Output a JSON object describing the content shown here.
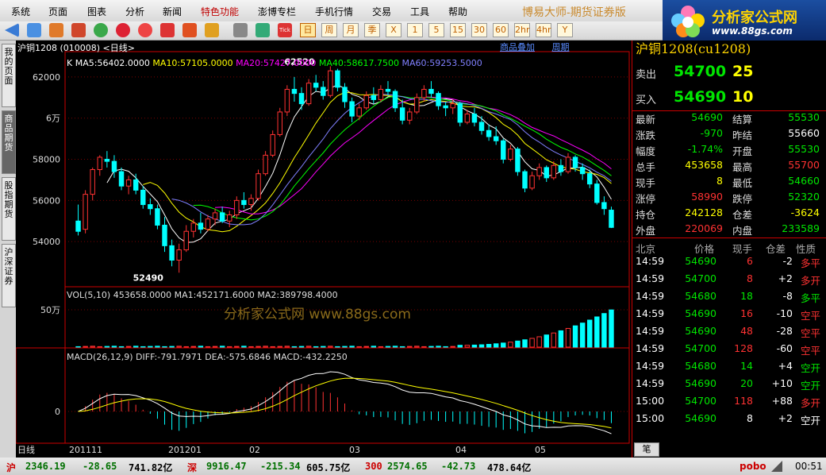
{
  "menu": [
    "系统",
    "页面",
    "图表",
    "分析",
    "新闻",
    "特色功能",
    "澎博专栏",
    "手机行情",
    "交易",
    "工具",
    "帮助"
  ],
  "brand": "博易大师-期货证券版",
  "logo": {
    "title": "分析家公式网",
    "url": "www.88gs.com"
  },
  "toolbar": {
    "period_tabs": [
      "日",
      "周",
      "月",
      "季",
      "X",
      "1",
      "5",
      "15",
      "30",
      "60",
      "2hr",
      "4hr",
      "Y"
    ],
    "tick_label": "Tick"
  },
  "sidebar": [
    "我的页面",
    "商品期货",
    "股指期货",
    "沪深证券"
  ],
  "chart": {
    "title": "沪铜1208 (010008)  <日线>",
    "links": [
      "商品叠加",
      "周期"
    ],
    "ma_label": "K",
    "ma": [
      {
        "t": "MA5:56402.0000",
        "c": "#ffffff"
      },
      {
        "t": "MA10:57105.0000",
        "c": "#ffff00"
      },
      {
        "t": "MA20:57427.0000",
        "c": "#ff00ff"
      },
      {
        "t": "MA40:58617.7500",
        "c": "#00ff00"
      },
      {
        "t": "MA60:59253.5000",
        "c": "#8080ff"
      }
    ],
    "y_ticks": [
      "62000",
      "6万",
      "58000",
      "56000",
      "54000"
    ],
    "hi_label": "62520",
    "lo_label": "52490",
    "vol_title": "VOL(5,10) 453658.0000 MA1:452171.6000 MA2:389798.4000",
    "vol_tick": "50万",
    "macd_title": "MACD(26,12,9) DIFF:-791.7971 DEA:-575.6846 MACD:-432.2250",
    "macd_tick": "0",
    "x_labels": [
      "日线",
      "201111",
      "201201",
      "02",
      "03",
      "04",
      "05"
    ],
    "watermark": "分析家公式网 www.88gs.com"
  },
  "quote": {
    "header": "沪铜1208(cu1208)",
    "sell": {
      "label": "卖出",
      "price": "54700",
      "vol": "25"
    },
    "buy": {
      "label": "买入",
      "price": "54690",
      "vol": "10"
    },
    "rows": [
      [
        [
          "最新",
          "54690",
          "green"
        ],
        [
          "结算",
          "55530",
          "green"
        ]
      ],
      [
        [
          "涨跌",
          "-970",
          "green"
        ],
        [
          "昨结",
          "55660",
          "white"
        ]
      ],
      [
        [
          "幅度",
          "-1.74%",
          "green"
        ],
        [
          "开盘",
          "55530",
          "green"
        ]
      ],
      [
        [
          "总手",
          "453658",
          "yellow"
        ],
        [
          "最高",
          "55700",
          "red"
        ]
      ],
      [
        [
          "现手",
          "8",
          "yellow"
        ],
        [
          "最低",
          "54660",
          "green"
        ]
      ],
      [
        [
          "涨停",
          "58990",
          "red"
        ],
        [
          "跌停",
          "52320",
          "green"
        ]
      ],
      [
        [
          "持仓",
          "242128",
          "yellow"
        ],
        [
          "仓差",
          "-3624",
          "yellow"
        ]
      ],
      [
        [
          "外盘",
          "220069",
          "red"
        ],
        [
          "内盘",
          "233589",
          "green"
        ]
      ]
    ],
    "tick_header": [
      "北京",
      "价格",
      "现手",
      "仓差",
      "性质"
    ],
    "ticks": [
      [
        "14:59",
        "54690",
        "6",
        "-2",
        "多平",
        "red"
      ],
      [
        "14:59",
        "54700",
        "8",
        "+2",
        "多开",
        "red"
      ],
      [
        "14:59",
        "54680",
        "18",
        "-8",
        "多平",
        "green"
      ],
      [
        "14:59",
        "54690",
        "16",
        "-10",
        "空平",
        "red"
      ],
      [
        "14:59",
        "54690",
        "48",
        "-28",
        "空平",
        "red"
      ],
      [
        "14:59",
        "54700",
        "128",
        "-60",
        "空平",
        "red"
      ],
      [
        "14:59",
        "54680",
        "14",
        "+4",
        "空开",
        "green"
      ],
      [
        "14:59",
        "54690",
        "20",
        "+10",
        "空开",
        "green"
      ],
      [
        "15:00",
        "54700",
        "118",
        "+88",
        "多开",
        "red"
      ],
      [
        "15:00",
        "54690",
        "8",
        "+2",
        "空开",
        "white"
      ]
    ],
    "tab": "笔"
  },
  "status": {
    "sh": {
      "name": "沪",
      "idx": "2346.19",
      "chg": "-28.65",
      "amt": "741.82亿"
    },
    "sz": {
      "name": "深",
      "idx": "9916.47",
      "chg": "-215.34",
      "amt": "605.75亿"
    },
    "hs": {
      "name": "300",
      "idx": "2574.65",
      "chg": "-42.73",
      "amt": "478.64亿"
    },
    "brand": "pobo",
    "time": "00:51"
  },
  "chart_data": {
    "type": "candlestick",
    "title": "沪铜1208 (010008) <日线>",
    "categories_sample": [
      "201111",
      "201201",
      "02",
      "03",
      "04",
      "05"
    ],
    "ohlc": [
      [
        55000,
        55800,
        54300,
        54500
      ],
      [
        54600,
        56500,
        54400,
        56300
      ],
      [
        56300,
        57600,
        56000,
        57500
      ],
      [
        57500,
        58200,
        57200,
        58100
      ],
      [
        58000,
        58400,
        57600,
        57900
      ],
      [
        57900,
        58200,
        57100,
        57400
      ],
      [
        57400,
        57600,
        56500,
        56700
      ],
      [
        56700,
        57200,
        56300,
        57000
      ],
      [
        57000,
        57300,
        56300,
        56500
      ],
      [
        56500,
        56700,
        55600,
        55800
      ],
      [
        55800,
        56100,
        55300,
        55600
      ],
      [
        55600,
        55800,
        54600,
        54800
      ],
      [
        54800,
        55200,
        53500,
        53800
      ],
      [
        53800,
        54100,
        52800,
        53100
      ],
      [
        53100,
        53900,
        52490,
        53600
      ],
      [
        53600,
        54800,
        53500,
        54500
      ],
      [
        54500,
        55100,
        54200,
        54900
      ],
      [
        54900,
        55400,
        54400,
        54600
      ],
      [
        54600,
        55300,
        54500,
        55100
      ],
      [
        55100,
        55600,
        54800,
        55400
      ],
      [
        55400,
        55700,
        54900,
        55000
      ],
      [
        55000,
        55500,
        54700,
        55300
      ],
      [
        55300,
        56200,
        55100,
        56000
      ],
      [
        56000,
        56400,
        55600,
        55800
      ],
      [
        55800,
        56300,
        55500,
        56100
      ],
      [
        56100,
        57500,
        56000,
        57300
      ],
      [
        57300,
        58400,
        57200,
        58200
      ],
      [
        58200,
        59400,
        58100,
        59200
      ],
      [
        59200,
        60500,
        59100,
        60300
      ],
      [
        60300,
        61600,
        60100,
        61400
      ],
      [
        61400,
        62000,
        60800,
        61200
      ],
      [
        61200,
        61500,
        60400,
        60700
      ],
      [
        60700,
        61900,
        60600,
        61700
      ],
      [
        61700,
        62100,
        61300,
        61500
      ],
      [
        61500,
        61800,
        60900,
        61100
      ],
      [
        61100,
        62520,
        61000,
        62300
      ],
      [
        62300,
        62400,
        61300,
        61500
      ],
      [
        61500,
        61700,
        60500,
        60800
      ],
      [
        60800,
        61000,
        59800,
        60100
      ],
      [
        60100,
        60700,
        59900,
        60500
      ],
      [
        60500,
        61300,
        60400,
        61100
      ],
      [
        61100,
        61500,
        60700,
        60900
      ],
      [
        60900,
        61600,
        60800,
        61400
      ],
      [
        61400,
        61800,
        61100,
        61300
      ],
      [
        61300,
        61400,
        60300,
        60500
      ],
      [
        60500,
        60900,
        59700,
        59900
      ],
      [
        59900,
        60500,
        59700,
        60300
      ],
      [
        60300,
        61200,
        60200,
        61000
      ],
      [
        61000,
        61600,
        60800,
        61400
      ],
      [
        61400,
        61800,
        61000,
        61200
      ],
      [
        61200,
        61300,
        60400,
        60600
      ],
      [
        60600,
        60800,
        60100,
        60500
      ],
      [
        60500,
        60900,
        60200,
        60700
      ],
      [
        60700,
        60800,
        59600,
        59800
      ],
      [
        59800,
        60400,
        59700,
        60200
      ],
      [
        60200,
        60500,
        59600,
        59800
      ],
      [
        59800,
        60100,
        59200,
        59400
      ],
      [
        59400,
        59700,
        58900,
        59100
      ],
      [
        59100,
        59600,
        58700,
        58900
      ],
      [
        58900,
        59000,
        57800,
        58000
      ],
      [
        58000,
        58700,
        57900,
        58500
      ],
      [
        58500,
        58600,
        57200,
        57400
      ],
      [
        57400,
        57500,
        56400,
        56600
      ],
      [
        56600,
        57400,
        56500,
        57200
      ],
      [
        57200,
        57800,
        57000,
        57600
      ],
      [
        57600,
        57700,
        56900,
        57100
      ],
      [
        57100,
        57900,
        57000,
        57700
      ],
      [
        57700,
        58000,
        57200,
        57400
      ],
      [
        57400,
        58300,
        57300,
        58100
      ],
      [
        58100,
        58200,
        57400,
        57600
      ],
      [
        57600,
        57800,
        57000,
        57300
      ],
      [
        57300,
        57500,
        56600,
        56800
      ],
      [
        56800,
        57000,
        55800,
        55900
      ],
      [
        55900,
        56200,
        55300,
        55600
      ],
      [
        55530,
        55700,
        54660,
        54690
      ]
    ],
    "volume_max_label": "50万",
    "macd": {
      "diff": -791.7971,
      "dea": -575.6846,
      "macd": -432.225
    }
  }
}
